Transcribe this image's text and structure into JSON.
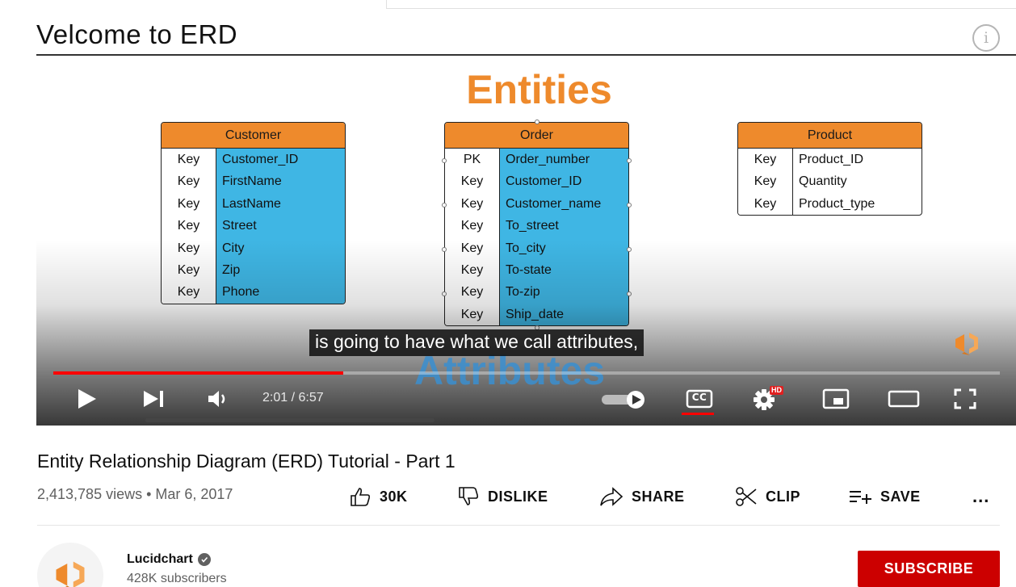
{
  "player": {
    "slide_title": "Velcome to ERD",
    "entities_heading": "Entities",
    "attributes_heading": "Attributes",
    "caption": "is going to have what we call attributes,",
    "progress_fraction": 0.306,
    "time_display": "2:01 / 6:57",
    "info_glyph": "i",
    "icons": [
      "play-icon",
      "next-icon",
      "volume-icon",
      "autoplay-toggle-icon",
      "captions-icon",
      "settings-icon",
      "miniplayer-icon",
      "theater-icon",
      "fullscreen-icon",
      "info-icon"
    ],
    "settings_badge": "HD",
    "cc_label": "CC",
    "accent": "#ff0000"
  },
  "entities": {
    "customer": {
      "title": "Customer",
      "rows": [
        {
          "key": "Key",
          "field": "Customer_ID"
        },
        {
          "key": "Key",
          "field": "FirstName"
        },
        {
          "key": "Key",
          "field": "LastName"
        },
        {
          "key": "Key",
          "field": "Street"
        },
        {
          "key": "Key",
          "field": "City"
        },
        {
          "key": "Key",
          "field": "Zip"
        },
        {
          "key": "Key",
          "field": "Phone"
        }
      ]
    },
    "order": {
      "title": "Order",
      "rows": [
        {
          "key": "PK",
          "field": "Order_number"
        },
        {
          "key": "Key",
          "field": "Customer_ID"
        },
        {
          "key": "Key",
          "field": "Customer_name"
        },
        {
          "key": "Key",
          "field": "To_street"
        },
        {
          "key": "Key",
          "field": "To_city"
        },
        {
          "key": "Key",
          "field": "To-state"
        },
        {
          "key": "Key",
          "field": "To-zip"
        },
        {
          "key": "Key",
          "field": "Ship_date"
        }
      ]
    },
    "product": {
      "title": "Product",
      "rows": [
        {
          "key": "Key",
          "field": "Product_ID"
        },
        {
          "key": "Key",
          "field": "Quantity"
        },
        {
          "key": "Key",
          "field": "Product_type"
        }
      ]
    },
    "colors": {
      "header": "#ee8a2c",
      "field": "#3fb6e4"
    }
  },
  "video": {
    "title": "Entity Relationship Diagram (ERD) Tutorial - Part 1",
    "meta": "2,413,785 views • Mar 6, 2017",
    "actions": {
      "like": "30K",
      "dislike": "DISLIKE",
      "share": "SHARE",
      "clip": "CLIP",
      "save": "SAVE",
      "more": "..."
    }
  },
  "channel": {
    "name": "Lucidchart",
    "subscribers": "428K subscribers",
    "subscribe_label": "SUBSCRIBE",
    "subscribe_color": "#cc0000",
    "brand_color": "#ee8a2c"
  }
}
